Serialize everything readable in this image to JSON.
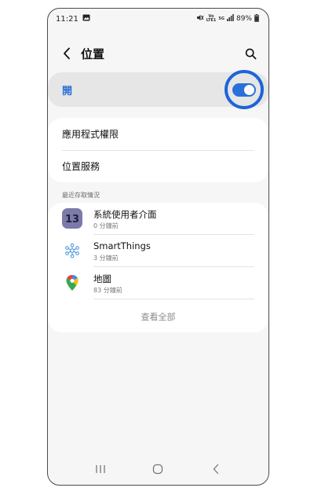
{
  "status_bar": {
    "time": "11:21",
    "network_top": "Vo",
    "network_sub": "LTE1",
    "signal_type": "5G",
    "battery": "89%"
  },
  "header": {
    "title": "位置"
  },
  "master_switch": {
    "label": "開",
    "state": "on",
    "accent_color": "#2b6fd9"
  },
  "permissions": {
    "items": [
      {
        "label": "應用程式權限"
      },
      {
        "label": "位置服務"
      }
    ]
  },
  "recent": {
    "header": "最近存取情況",
    "items": [
      {
        "name": "系統使用者介面",
        "time": "0 分鐘前",
        "icon": "system-ui-icon"
      },
      {
        "name": "SmartThings",
        "time": "3 分鐘前",
        "icon": "smartthings-icon"
      },
      {
        "name": "地圖",
        "time": "83 分鐘前",
        "icon": "maps-icon"
      }
    ],
    "see_all": "查看全部"
  },
  "nav": {
    "items": [
      "recent-apps-icon",
      "home-icon",
      "back-icon"
    ]
  }
}
